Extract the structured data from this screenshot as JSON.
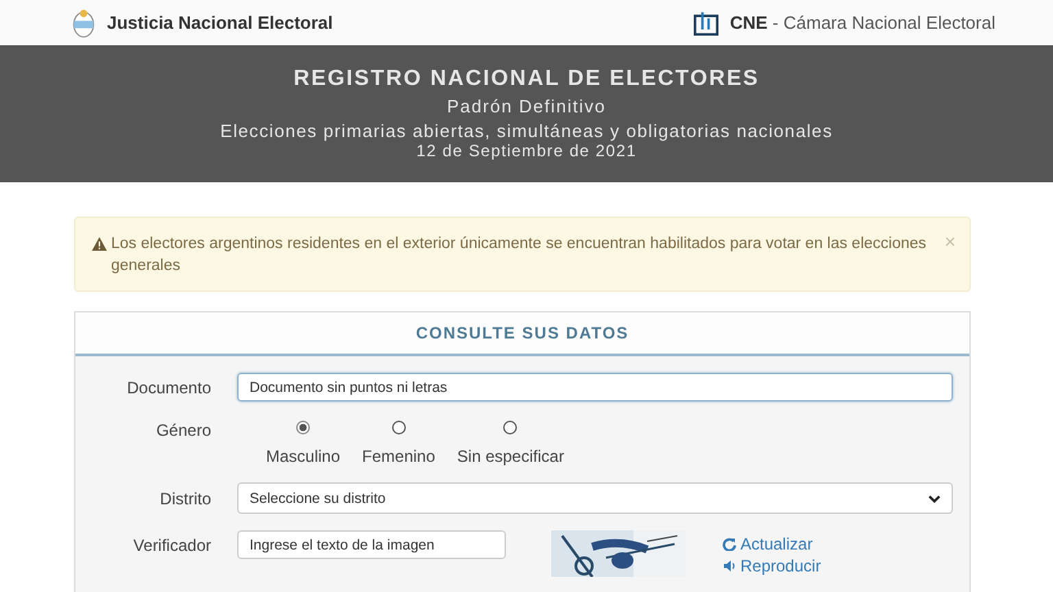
{
  "header": {
    "left_title": "Justicia Nacional Electoral",
    "right_brand": "CNE",
    "right_title": "- Cámara Nacional Electoral"
  },
  "banner": {
    "title": "REGISTRO NACIONAL DE ELECTORES",
    "subtitle": "Padrón Definitivo",
    "election": "Elecciones primarias abiertas, simultáneas y obligatorias nacionales",
    "date": "12 de Septiembre de 2021"
  },
  "alert": {
    "text": "Los electores argentinos residentes en el exterior únicamente se encuentran habilitados para votar en las elecciones generales",
    "close": "×"
  },
  "form": {
    "title": "CONSULTE SUS DATOS",
    "document": {
      "label": "Documento",
      "placeholder": "Documento sin puntos ni letras"
    },
    "gender": {
      "label": "Género",
      "options": [
        {
          "label": "Masculino",
          "selected": true
        },
        {
          "label": "Femenino",
          "selected": false
        },
        {
          "label": "Sin especificar",
          "selected": false
        }
      ]
    },
    "district": {
      "label": "Distrito",
      "placeholder": "Seleccione su distrito"
    },
    "verifier": {
      "label": "Verificador",
      "placeholder": "Ingrese el texto de la imagen",
      "captcha": {
        "kind": "picture"
      },
      "links": [
        "Actualizar",
        "Reproducir"
      ]
    }
  }
}
